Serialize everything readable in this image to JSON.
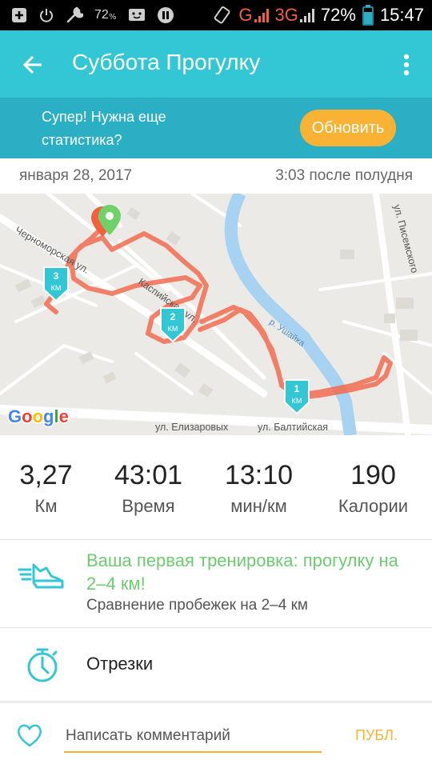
{
  "status_bar": {
    "left_icons": [
      "plus-box-icon",
      "power-icon",
      "wrench-icon",
      "battery-saver-icon",
      "face-icon",
      "pause-icon"
    ],
    "left_battery_text": "72",
    "network_g": "G",
    "network_3g": "3G",
    "battery_percent": "72%",
    "time": "15:47"
  },
  "app_bar": {
    "title": "Суббота Прогулку"
  },
  "promo": {
    "text": "Супер! Нужна еще статистика?",
    "button": "Обновить"
  },
  "date_line": {
    "date": "января 28, 2017",
    "time": "3:03 после полудня"
  },
  "map": {
    "streets": {
      "chernomorskaya": "Черноморская ул.",
      "kaspiyskaya": "Каспийская ул.",
      "pisemskogo": "ул. Писемского",
      "elizarovykh": "ул. Елизаровых",
      "baltiyskaya": "ул. Балтийская",
      "river": "р. Ушайка"
    },
    "km_markers": [
      {
        "num": "1",
        "unit": "КМ"
      },
      {
        "num": "2",
        "unit": "КМ"
      },
      {
        "num": "3",
        "unit": "КМ"
      }
    ],
    "logo": "Google",
    "colors": {
      "route": "#f26b4f",
      "river": "#a8d2f2",
      "marker": "#33c7d5",
      "start_pin": "#6fd167",
      "end_pin": "#f2603f"
    }
  },
  "stats": [
    {
      "value": "3,27",
      "label": "Км"
    },
    {
      "value": "43:01",
      "label": "Время"
    },
    {
      "value": "13:10",
      "label": "мин/км"
    },
    {
      "value": "190",
      "label": "Калории"
    }
  ],
  "achievement": {
    "title": "Ваша первая тренировка: прогулку на 2–4 км!",
    "subtitle": "Сравнение пробежек на 2–4 км"
  },
  "splits": {
    "label": "Отрезки"
  },
  "comment": {
    "placeholder": "Написать комментарий",
    "publish": "ПУБЛ."
  },
  "colors": {
    "primary": "#33c7d5",
    "promo_bg": "#2bafc5",
    "accent": "#f9b233",
    "achievement_green": "#6dcc6f"
  }
}
